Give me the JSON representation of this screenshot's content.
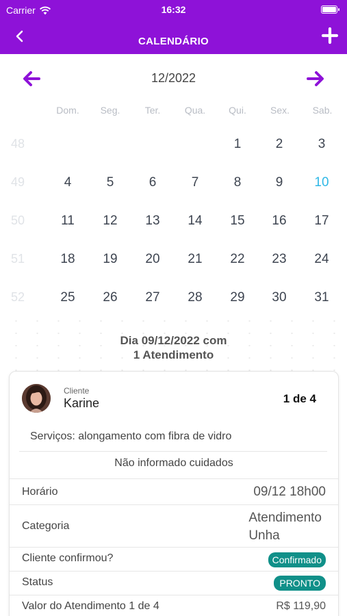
{
  "status_bar": {
    "carrier": "Carrier",
    "time": "16:32"
  },
  "header": {
    "title": "CALENDÁRIO"
  },
  "calendar": {
    "month": "12/2022",
    "weekdays": [
      "Dom.",
      "Seg.",
      "Ter.",
      "Qua.",
      "Qui.",
      "Sex.",
      "Sab."
    ],
    "weeks": [
      {
        "number": "48",
        "days": [
          "",
          "",
          "",
          "",
          "1",
          "2",
          "3"
        ]
      },
      {
        "number": "49",
        "days": [
          "4",
          "5",
          "6",
          "7",
          "8",
          "9",
          "10"
        ]
      },
      {
        "number": "50",
        "days": [
          "11",
          "12",
          "13",
          "14",
          "15",
          "16",
          "17"
        ]
      },
      {
        "number": "51",
        "days": [
          "18",
          "19",
          "20",
          "21",
          "22",
          "23",
          "24"
        ]
      },
      {
        "number": "52",
        "days": [
          "25",
          "26",
          "27",
          "28",
          "29",
          "30",
          "31"
        ]
      }
    ],
    "highlighted_day": "10",
    "highlight_color": "#2fb8e6"
  },
  "summary": {
    "line1": "Dia 09/12/2022 com",
    "line2": "1 Atendimento"
  },
  "appointment": {
    "client_caption": "Cliente",
    "client_name": "Karine",
    "counter": "1 de 4",
    "services": "Serviços: alongamento com fibra de vidro",
    "care": "Não informado cuidados",
    "time_label": "Horário",
    "time_value": "09/12 18h00",
    "category_label": "Categoria",
    "category_value_line1": "Atendimento",
    "category_value_line2": "Unha",
    "confirmed_label": "Cliente confirmou?",
    "confirmed_badge": "Confirmado",
    "status_label": "Status",
    "status_badge": "PRONTO",
    "price_label": "Valor do Atendimento 1 de 4",
    "price_value": "R$ 119,90"
  },
  "colors": {
    "brand": "#8e12d8",
    "badge": "#109089"
  }
}
